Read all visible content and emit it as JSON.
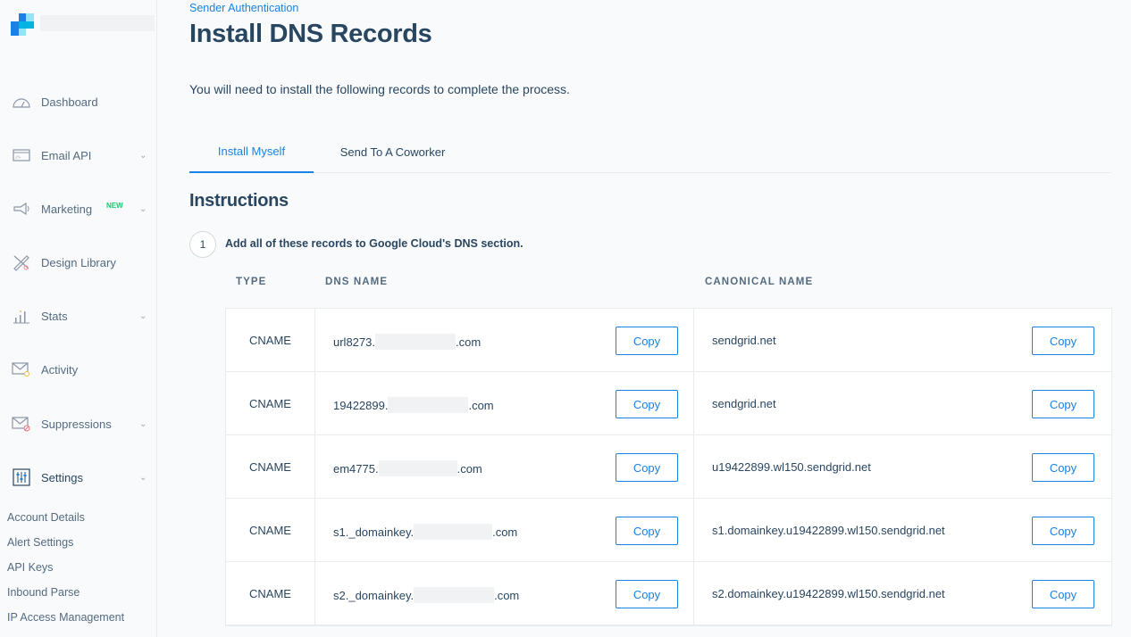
{
  "sidebar": {
    "nav": [
      {
        "label": "Dashboard",
        "icon": "dashboard-gauge-icon",
        "chevron": false
      },
      {
        "label": "Email API",
        "icon": "code-window-icon",
        "chevron": true
      },
      {
        "label": "Marketing",
        "icon": "megaphone-icon",
        "chevron": true,
        "badge": "NEW"
      },
      {
        "label": "Design Library",
        "icon": "design-tools-icon",
        "chevron": false
      },
      {
        "label": "Stats",
        "icon": "bar-chart-icon",
        "chevron": true
      },
      {
        "label": "Activity",
        "icon": "envelope-search-icon",
        "chevron": false
      },
      {
        "label": "Suppressions",
        "icon": "envelope-blocked-icon",
        "chevron": true
      },
      {
        "label": "Settings",
        "icon": "settings-sliders-icon",
        "chevron": true
      }
    ],
    "settings_sub": [
      "Account Details",
      "Alert Settings",
      "API Keys",
      "Inbound Parse",
      "IP Access Management"
    ],
    "chevron_glyph": "⌄"
  },
  "main": {
    "breadcrumb": "Sender Authentication",
    "title": "Install DNS Records",
    "intro": "You will need to install the following records to complete the process.",
    "tabs": [
      {
        "label": "Install Myself",
        "active": true
      },
      {
        "label": "Send To A Coworker",
        "active": false
      }
    ],
    "section_title": "Instructions",
    "step": {
      "number": "1",
      "text": "Add all of these records to Google Cloud's DNS section."
    },
    "table": {
      "headers": {
        "type": "TYPE",
        "dns": "DNS NAME",
        "canonical": "CANONICAL NAME"
      },
      "copy_label": "Copy",
      "rows": [
        {
          "type": "CNAME",
          "dns_prefix": "url8273.",
          "dns_suffix": ".com",
          "canonical": "sendgrid.net"
        },
        {
          "type": "CNAME",
          "dns_prefix": "19422899.",
          "dns_suffix": ".com",
          "canonical": "sendgrid.net"
        },
        {
          "type": "CNAME",
          "dns_prefix": "em4775.",
          "dns_suffix": ".com",
          "canonical": "u19422899.wl150.sendgrid.net"
        },
        {
          "type": "CNAME",
          "dns_prefix": "s1._domainkey.",
          "dns_suffix": ".com",
          "canonical": "s1.domainkey.u19422899.wl150.sendgrid.net"
        },
        {
          "type": "CNAME",
          "dns_prefix": "s2._domainkey.",
          "dns_suffix": ".com",
          "canonical": "s2.domainkey.u19422899.wl150.sendgrid.net"
        }
      ]
    }
  },
  "colors": {
    "accent": "#1a82e2",
    "text": "#294661",
    "new_badge": "#18c96e",
    "logo": [
      "#1a82e2",
      "#99e1f4",
      "#00b3e3",
      "#263746"
    ]
  }
}
